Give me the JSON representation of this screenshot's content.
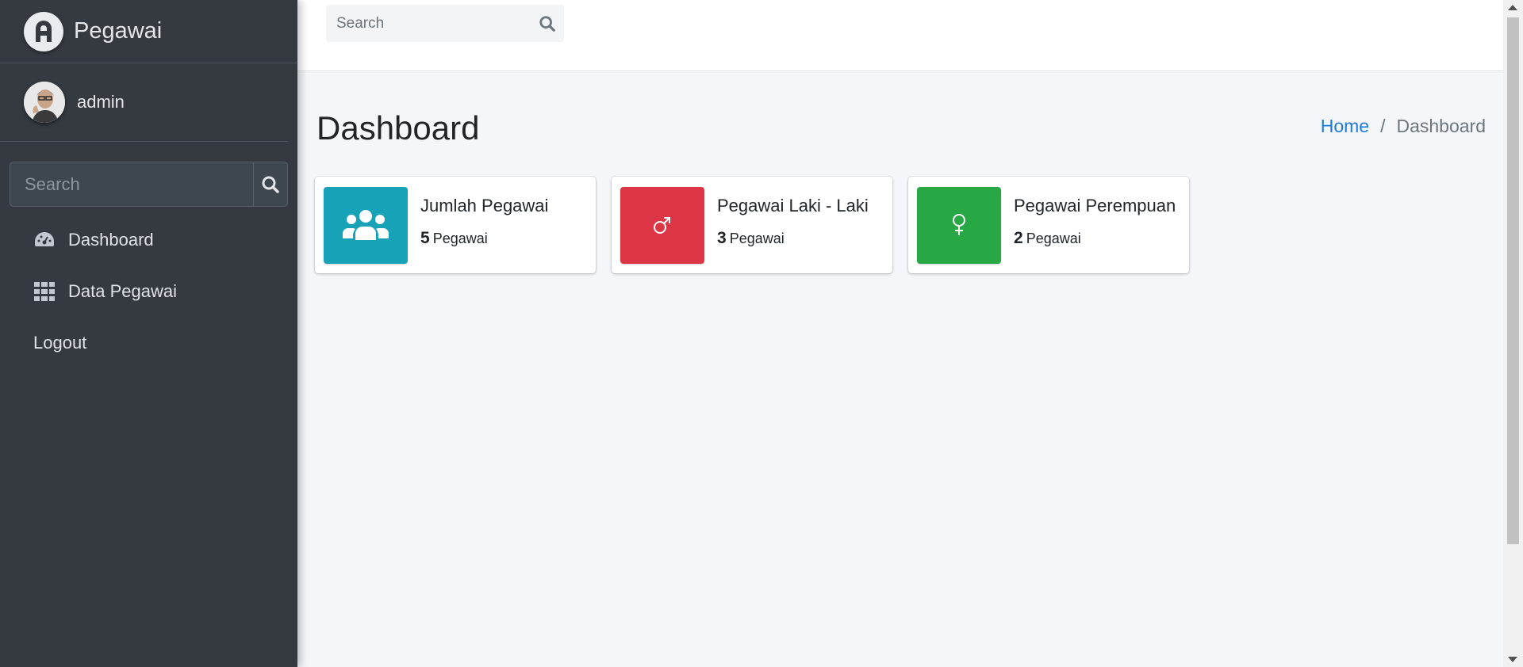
{
  "brand": {
    "name": "Pegawai",
    "logo_icon": "brand-logo-icon"
  },
  "user": {
    "name": "admin"
  },
  "sidebar": {
    "search": {
      "placeholder": "Search"
    },
    "items": [
      {
        "label": "Dashboard",
        "icon": "tachometer-icon"
      },
      {
        "label": "Data Pegawai",
        "icon": "grid-icon"
      },
      {
        "label": "Logout"
      }
    ]
  },
  "topbar": {
    "search": {
      "placeholder": "Search"
    }
  },
  "page": {
    "title": "Dashboard",
    "breadcrumb": {
      "home": "Home",
      "separator": "/",
      "current": "Dashboard"
    }
  },
  "cards": [
    {
      "label": "Jumlah Pegawai",
      "count": "5",
      "unit": "Pegawai",
      "color": "#17a2b8",
      "icon": "users-icon"
    },
    {
      "label": "Pegawai Laki - Laki",
      "count": "3",
      "unit": "Pegawai",
      "color": "#dc3545",
      "icon": "male-icon"
    },
    {
      "label": "Pegawai Perempuan",
      "count": "2",
      "unit": "Pegawai",
      "color": "#28a745",
      "icon": "female-icon"
    }
  ],
  "colors": {
    "sidebar_bg": "#343a40",
    "link": "#1f7ad8",
    "content_bg": "#f4f6f9"
  }
}
